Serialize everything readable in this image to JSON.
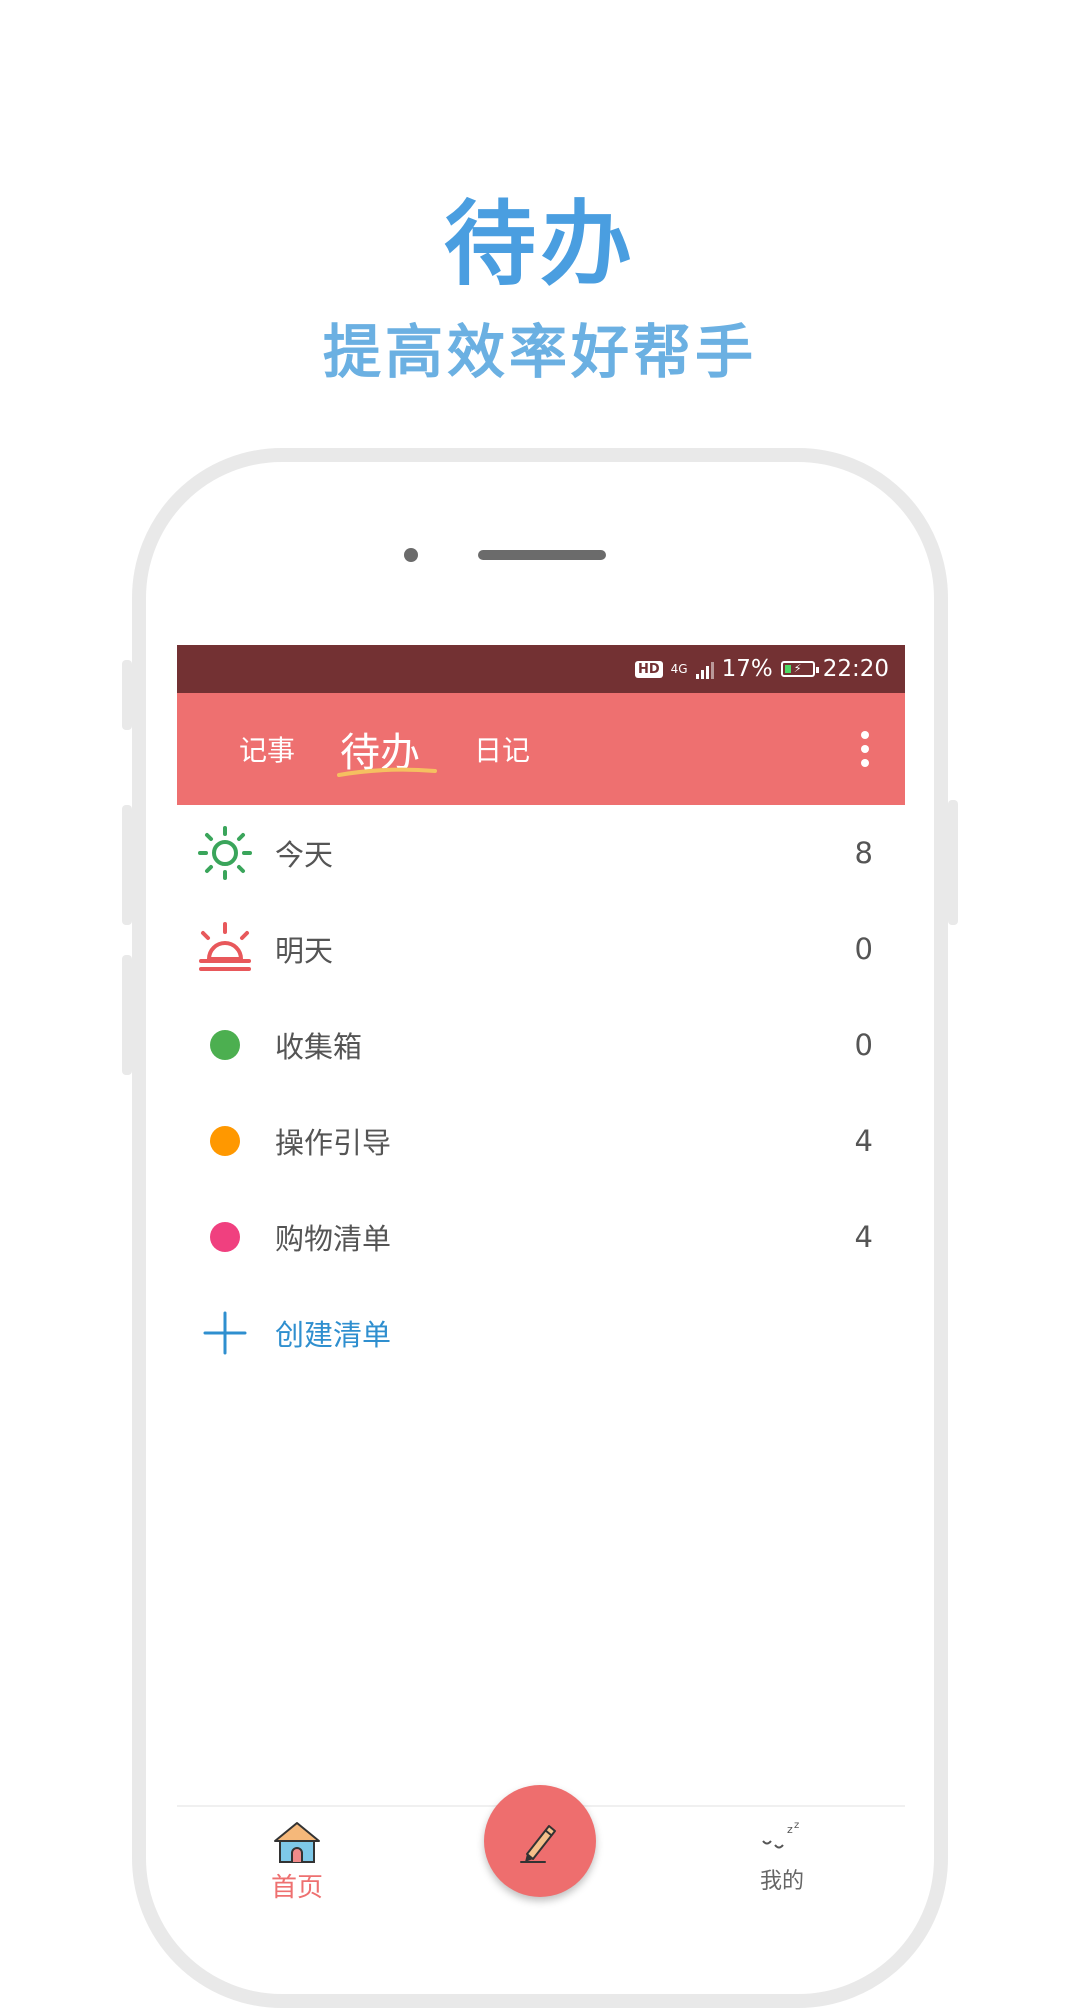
{
  "promo": {
    "title": "待办",
    "subtitle": "提高效率好帮手"
  },
  "status_bar": {
    "hd": "HD",
    "network": "4G",
    "battery": "17%",
    "time": "22:20"
  },
  "app_bar": {
    "tabs": [
      {
        "label": "记事"
      },
      {
        "label": "待办",
        "active": true
      },
      {
        "label": "日记"
      }
    ]
  },
  "lists": [
    {
      "label": "今天",
      "count": "8",
      "icon": "sun-icon",
      "color": "#3aa55b"
    },
    {
      "label": "明天",
      "count": "0",
      "icon": "sunrise-icon",
      "color": "#e8585b"
    },
    {
      "label": "收集箱",
      "count": "0",
      "icon": "dot",
      "color": "#4caf50"
    },
    {
      "label": "操作引导",
      "count": "4",
      "icon": "dot",
      "color": "#ff9800"
    },
    {
      "label": "购物清单",
      "count": "4",
      "icon": "dot",
      "color": "#f0407f"
    }
  ],
  "create_list": {
    "label": "创建清单",
    "color": "#2f8fcf"
  },
  "bottom_nav": {
    "home": "首页",
    "mine": "我的"
  },
  "colors": {
    "accent": "#ee7070",
    "status_bar": "#733133",
    "headline": "#4a9ee0"
  }
}
